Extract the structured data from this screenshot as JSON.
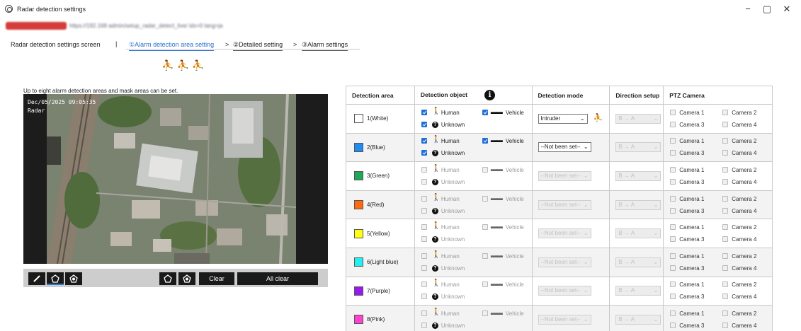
{
  "window": {
    "title": "Radar detection settings",
    "minimize": "−",
    "maximize": "▢",
    "close": "✕"
  },
  "nav": {
    "screen_label": "Radar detection settings screen",
    "separator": "|",
    "tabs": [
      {
        "label": "①Alarm detection area setting"
      },
      {
        "label": "②Detailed setting"
      },
      {
        "label": "③Alarm settings"
      }
    ],
    "arrow": ">"
  },
  "description": "Up to eight alarm detection areas and mask areas can be set.",
  "map_overlay": {
    "date": "Dec/05/2025  09:05:35",
    "label": "Radar"
  },
  "toolbar": {
    "clear_label": "Clear",
    "all_clear_label": "All clear"
  },
  "table": {
    "headers": {
      "area": "Detection area",
      "object": "Detection object",
      "mode": "Detection mode",
      "direction": "Direction setup",
      "ptz": "PTZ Camera"
    },
    "object_labels": {
      "human": "Human",
      "vehicle": "Vehicle",
      "unknown": "Unknown"
    },
    "camera_labels": [
      "Camera 1",
      "Camera 2",
      "Camera 3",
      "Camera 4"
    ],
    "direction_value": "B → A",
    "rows": [
      {
        "label": "1(White)",
        "color": "#ffffff",
        "enabled": true,
        "human": true,
        "vehicle": true,
        "unknown": true,
        "mode": "Intruder",
        "mode_active": true
      },
      {
        "label": "2(Blue)",
        "color": "#1e8cf0",
        "enabled": true,
        "human": true,
        "vehicle": true,
        "unknown": true,
        "mode": "--Not been set--",
        "mode_active": true
      },
      {
        "label": "3(Green)",
        "color": "#1da85a",
        "enabled": false,
        "human": false,
        "vehicle": false,
        "unknown": false,
        "mode": "--Not been set--",
        "mode_active": false
      },
      {
        "label": "4(Red)",
        "color": "#ff6a10",
        "enabled": false,
        "human": false,
        "vehicle": false,
        "unknown": false,
        "mode": "--Not been set--",
        "mode_active": false
      },
      {
        "label": "5(Yellow)",
        "color": "#ffff10",
        "enabled": false,
        "human": false,
        "vehicle": false,
        "unknown": false,
        "mode": "--Not been set--",
        "mode_active": false
      },
      {
        "label": "6(Light blue)",
        "color": "#20f0f0",
        "enabled": false,
        "human": false,
        "vehicle": false,
        "unknown": false,
        "mode": "--Not been set--",
        "mode_active": false
      },
      {
        "label": "7(Purple)",
        "color": "#9a18f0",
        "enabled": false,
        "human": false,
        "vehicle": false,
        "unknown": false,
        "mode": "--Not been set--",
        "mode_active": false
      },
      {
        "label": "8(Pink)",
        "color": "#ff40d0",
        "enabled": false,
        "human": false,
        "vehicle": false,
        "unknown": false,
        "mode": "--Not been set--",
        "mode_active": false
      }
    ]
  }
}
